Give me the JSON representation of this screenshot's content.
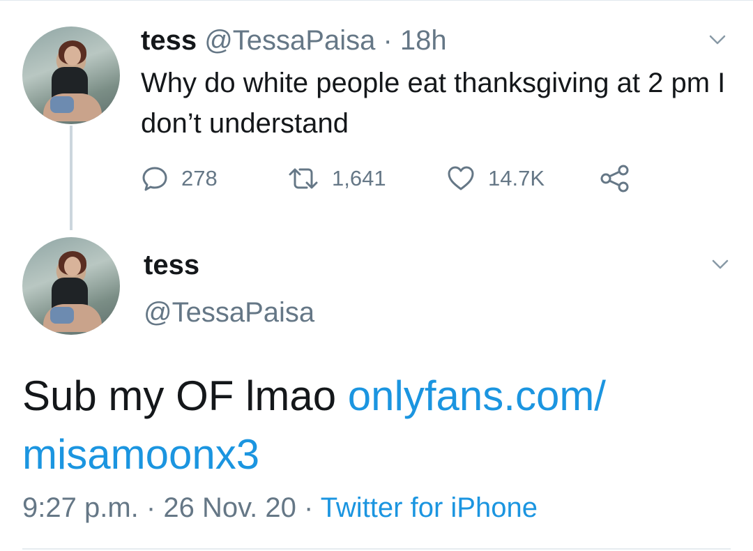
{
  "tweet1": {
    "name": "tess",
    "handle": "@TessaPaisa",
    "separator": "·",
    "time": "18h",
    "text": "Why do white people eat thanksgiving at 2 pm I don’t understand",
    "actions": {
      "replies": "278",
      "retweets": "1,641",
      "likes": "14.7K"
    }
  },
  "tweet2": {
    "name": "tess",
    "handle": "@TessaPaisa",
    "text": "Sub my OF lmao ",
    "link_line1": "onlyfans.com/",
    "link_line2": "misamoonx3",
    "time": "9:27 p.m.",
    "separator": "·",
    "date": "26 Nov. 20",
    "source": "Twitter for iPhone"
  },
  "icons": {
    "reply": "reply-icon",
    "retweet": "retweet-icon",
    "like": "heart-icon",
    "share": "share-icon",
    "menu": "chevron-down-icon"
  },
  "colors": {
    "text": "#14171a",
    "secondary": "#657786",
    "link": "#1b95e0",
    "thread_line": "#ccd6dd"
  }
}
